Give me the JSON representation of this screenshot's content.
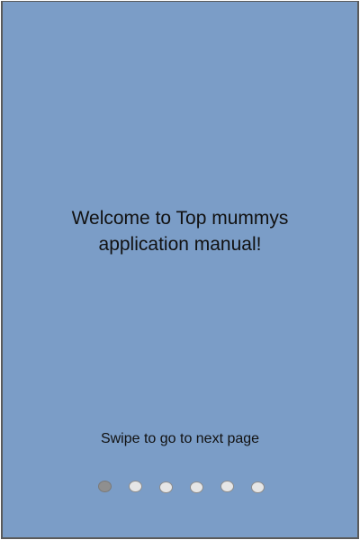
{
  "welcome": {
    "line1": "Welcome to Top mummys",
    "line2": "application manual!"
  },
  "hint": {
    "text": "Swipe to go to next page"
  },
  "pager": {
    "total_pages": 6,
    "current_page": 1
  },
  "colors": {
    "background": "#7b9dc7",
    "border": "#5a5a5a",
    "dot_active": "#8f8f8f",
    "dot_inactive": "#e6e6e6"
  }
}
